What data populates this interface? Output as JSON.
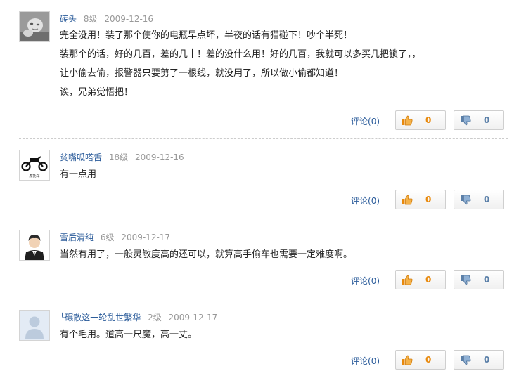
{
  "comments": [
    {
      "username": "砖头",
      "level": "8级",
      "date": "2009-12-16",
      "avatar_icon": "baby-photo-icon",
      "lines": [
        "完全没用！装了那个使你的电瓶早点坏，半夜的话有猫碰下！吵个半死！",
        "装那个的话，好的几百，差的几十！差的没什么用！好的几百，我就可以多买几把锁了，，",
        "让小偷去偷，报警器只要剪了一根线，就没用了，所以做小偷都知道！",
        "诶，兄弟觉悟把！"
      ],
      "reply_label": "评论",
      "reply_count": "(0)",
      "up_count": "0",
      "down_count": "0"
    },
    {
      "username": "贫嘴呱嗒舌",
      "level": "18级",
      "date": "2009-12-16",
      "avatar_icon": "motorcycle-icon",
      "avatar_caption": "摩托车",
      "lines": [
        "有一点用"
      ],
      "reply_label": "评论",
      "reply_count": "(0)",
      "up_count": "0",
      "down_count": "0"
    },
    {
      "username": "雪后清纯",
      "level": "6级",
      "date": "2009-12-17",
      "avatar_icon": "person-in-suit-icon",
      "lines": [
        "当然有用了，一般灵敏度高的还可以，就算高手偷车也需要一定难度啊。"
      ],
      "reply_label": "评论",
      "reply_count": "(0)",
      "up_count": "0",
      "down_count": "0"
    },
    {
      "username": "╰碾散这一轮乱世繁华",
      "level": "2级",
      "date": "2009-12-17",
      "avatar_icon": "default-user-icon",
      "lines": [
        "有个毛用。道高一尺魔，高一丈。"
      ],
      "reply_label": "评论",
      "reply_count": "(0)",
      "up_count": "0",
      "down_count": "0"
    }
  ],
  "colors": {
    "username": "#2a5b9a",
    "meta_gray": "#999999",
    "up_count": "#e8890c",
    "down_count": "#5a7fa8"
  }
}
